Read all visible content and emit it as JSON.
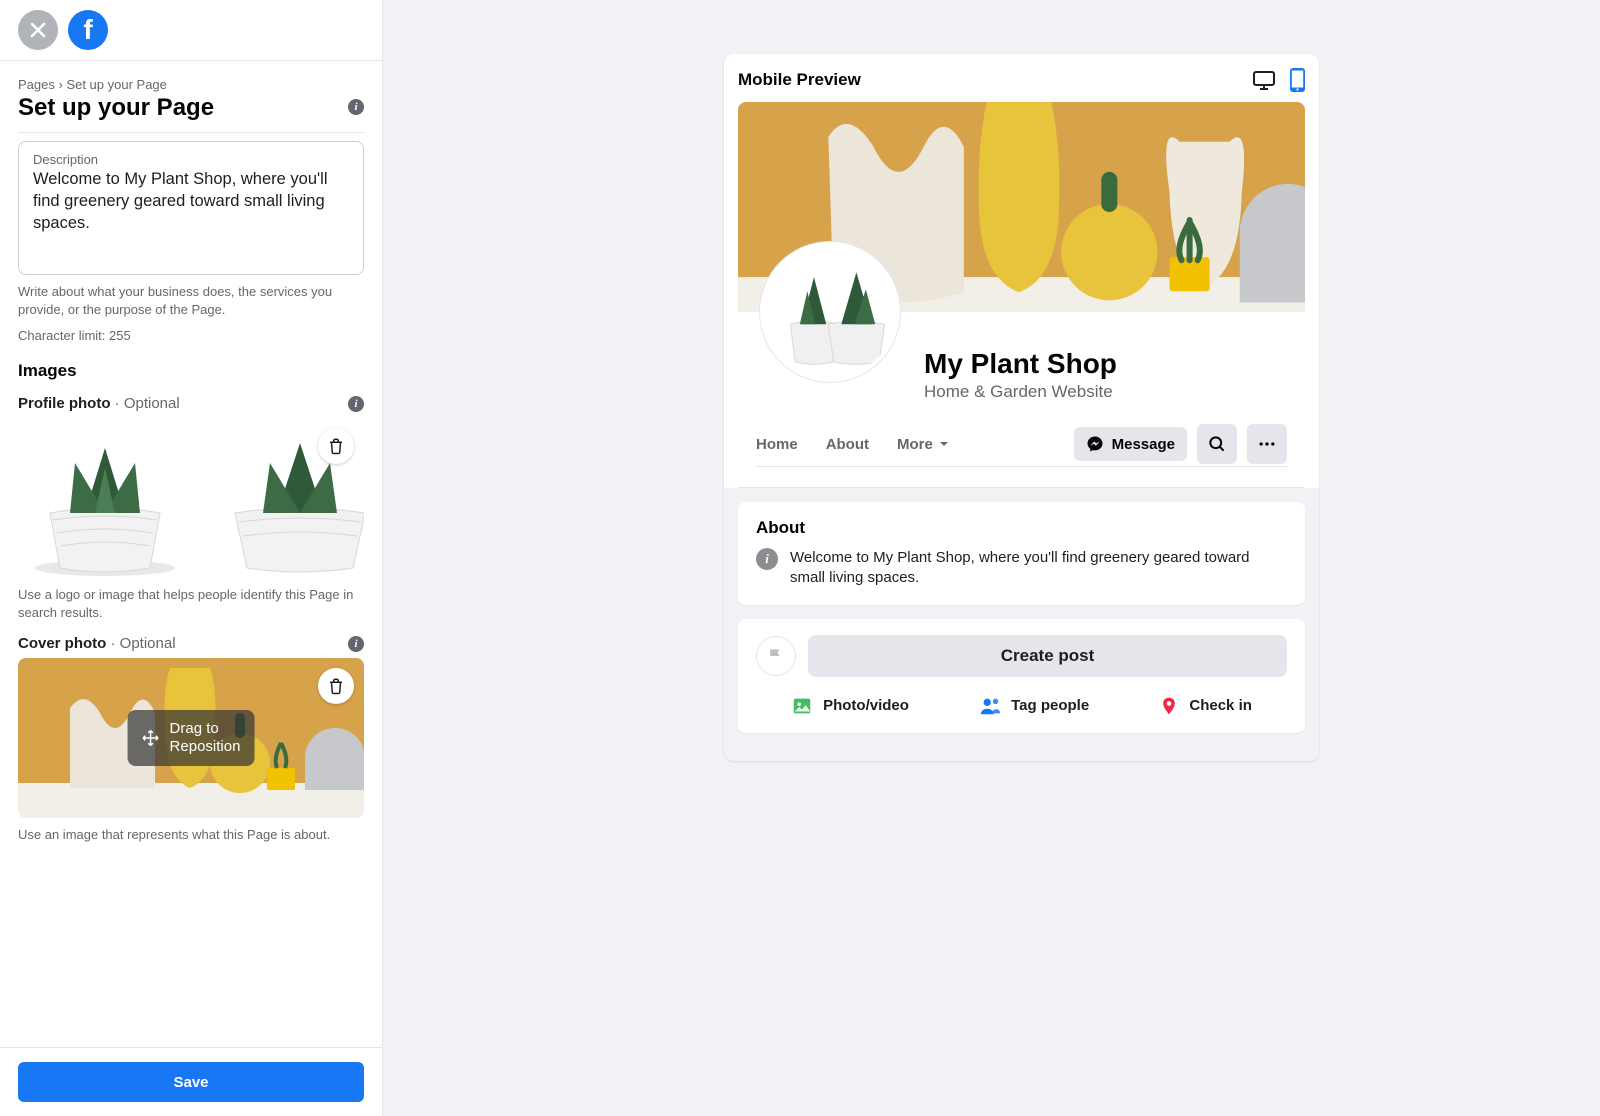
{
  "header": {
    "breadcrumb_root": "Pages",
    "breadcrumb_sep": " › ",
    "breadcrumb_leaf": "Set up your Page",
    "title": "Set up your Page"
  },
  "description": {
    "label": "Description",
    "value": "Welcome to My Plant Shop, where you'll find greenery geared toward small living spaces.",
    "help": "Write about what your business does, the services you provide, or the purpose of the Page.",
    "char_limit": "Character limit: 255"
  },
  "images": {
    "heading": "Images",
    "profile": {
      "label": "Profile photo",
      "optional": " · Optional",
      "help": "Use a logo or image that helps people identify this Page in search results."
    },
    "cover": {
      "label": "Cover photo",
      "optional": " · Optional",
      "drag_line1": "Drag to",
      "drag_line2": "Reposition",
      "help": "Use an image that represents what this Page is about."
    }
  },
  "footer": {
    "save": "Save"
  },
  "preview": {
    "title": "Mobile Preview",
    "page_name": "My Plant Shop",
    "category": "Home & Garden Website",
    "tabs": {
      "home": "Home",
      "about": "About",
      "more": "More"
    },
    "message_btn": "Message",
    "about": {
      "heading": "About",
      "text": "Welcome to My Plant Shop, where you'll find greenery geared toward small living spaces."
    },
    "composer": {
      "create": "Create post",
      "photo": "Photo/video",
      "tag": "Tag people",
      "checkin": "Check in"
    }
  }
}
